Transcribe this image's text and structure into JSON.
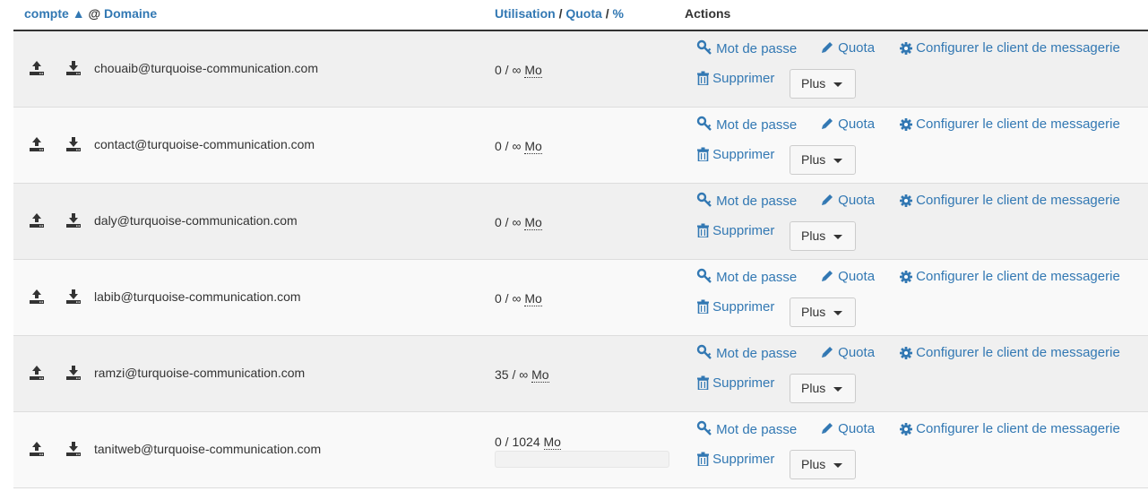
{
  "header": {
    "col_account": "compte",
    "sort_arrow": "▲",
    "at_symbol": "@",
    "col_domain": "Domaine",
    "col_usage": "Utilisation",
    "slash1": "/",
    "col_quota": "Quota",
    "slash2": "/",
    "col_percent": "%",
    "col_actions": "Actions"
  },
  "actions": {
    "password": "Mot de passe",
    "quota": "Quota",
    "configure": "Configurer le client de messagerie",
    "delete": "Supprimer",
    "more": "Plus"
  },
  "rows": [
    {
      "email": "chouaib@turquoise-communication.com",
      "usage": "0",
      "quota": "∞",
      "unit": "Mo"
    },
    {
      "email": "contact@turquoise-communication.com",
      "usage": "0",
      "quota": "∞",
      "unit": "Mo"
    },
    {
      "email": "daly@turquoise-communication.com",
      "usage": "0",
      "quota": "∞",
      "unit": "Mo"
    },
    {
      "email": "labib@turquoise-communication.com",
      "usage": "0",
      "quota": "∞",
      "unit": "Mo"
    },
    {
      "email": "ramzi@turquoise-communication.com",
      "usage": "35",
      "quota": "∞",
      "unit": "Mo"
    },
    {
      "email": "tanitweb@turquoise-communication.com",
      "usage": "0",
      "quota": "1024",
      "unit": "Mo",
      "usage_fraction": 0
    }
  ],
  "colors": {
    "link": "#3278b3",
    "text": "#333333",
    "row_odd": "#f0f0f0",
    "row_even": "#f9f9f9",
    "header_border": "#333333"
  },
  "icons": {
    "upload": "upload-icon",
    "download": "download-icon",
    "password": "key-icon",
    "quota": "pencil-icon",
    "configure": "gear-icon",
    "delete": "trash-icon",
    "more": "caret-down-icon"
  }
}
